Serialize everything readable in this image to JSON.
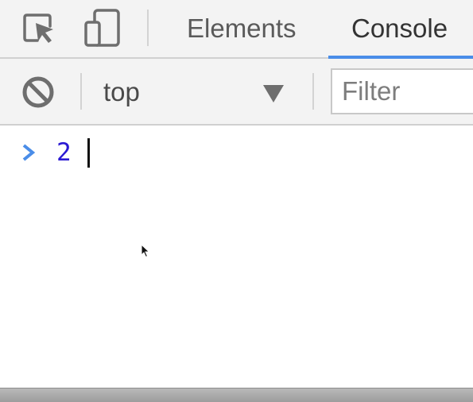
{
  "toolbar_top": {
    "inspect_icon": "inspect-element-icon",
    "device_icon": "device-toolbar-icon",
    "tabs": [
      {
        "label": "Elements",
        "active": false
      },
      {
        "label": "Console",
        "active": true
      }
    ]
  },
  "console_toolbar": {
    "clear_icon": "clear-console-icon",
    "context": {
      "selected": "top"
    },
    "filter": {
      "placeholder": "Filter",
      "value": ""
    }
  },
  "console": {
    "prompt_icon": "prompt-chevron-icon",
    "input_text": "2"
  },
  "colors": {
    "active_tab_underline": "#4a8de8",
    "prompt_chevron": "#4a8de8",
    "input_text": "#2b1ad3",
    "toolbar_bg": "#f3f3f3"
  }
}
